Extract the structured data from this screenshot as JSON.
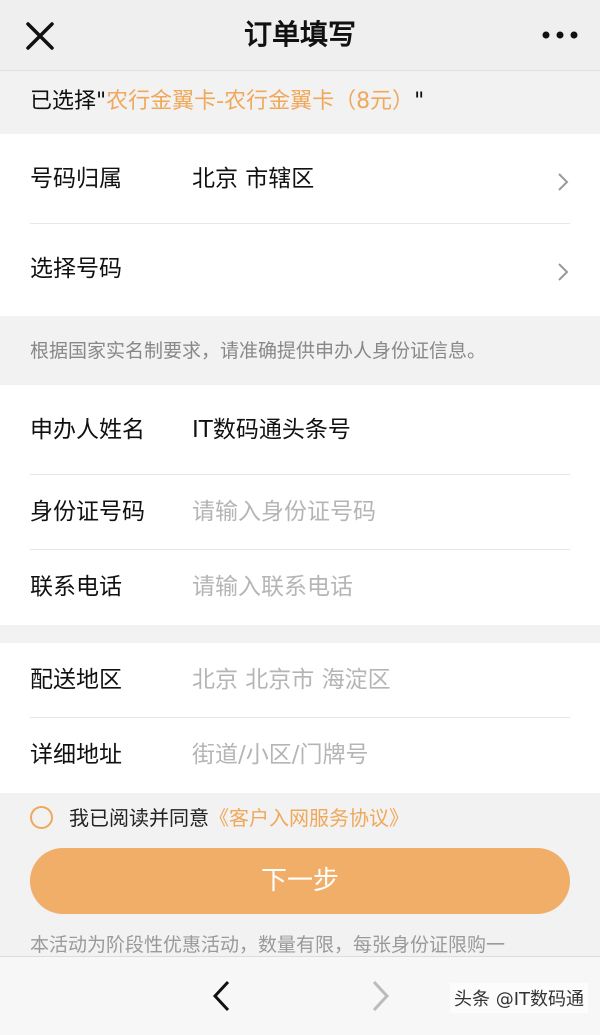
{
  "header": {
    "title": "订单填写",
    "close_icon": "close-icon",
    "more_icon": "more-dots-icon"
  },
  "selection": {
    "prefix": "已选择\"",
    "product": "农行金翼卡-农行金翼卡（8元）",
    "suffix": "\""
  },
  "number_section": {
    "location_label": "号码归属",
    "location_value": "北京 市辖区",
    "select_label": "选择号码",
    "select_value": ""
  },
  "notice": "根据国家实名制要求，请准确提供申办人身份证信息。",
  "identity_section": {
    "name_label": "申办人姓名",
    "name_value": "IT数码通头条号",
    "id_label": "身份证号码",
    "id_placeholder": "请输入身份证号码",
    "phone_label": "联系电话",
    "phone_placeholder": "请输入联系电话"
  },
  "address_section": {
    "region_label": "配送地区",
    "region_value": "北京 北京市 海淀区",
    "detail_label": "详细地址",
    "detail_placeholder": "街道/小区/门牌号"
  },
  "agreement": {
    "text": "我已阅读并同意",
    "link": "《客户入网服务协议》",
    "checked": false
  },
  "next_button": "下一步",
  "footnote": "本活动为阶段性优惠活动，数量有限，每张身份证限购一",
  "watermark": "头条 @IT数码通",
  "colors": {
    "accent": "#f0a85a",
    "button": "#f0ae68",
    "background": "#f2f2f2"
  }
}
